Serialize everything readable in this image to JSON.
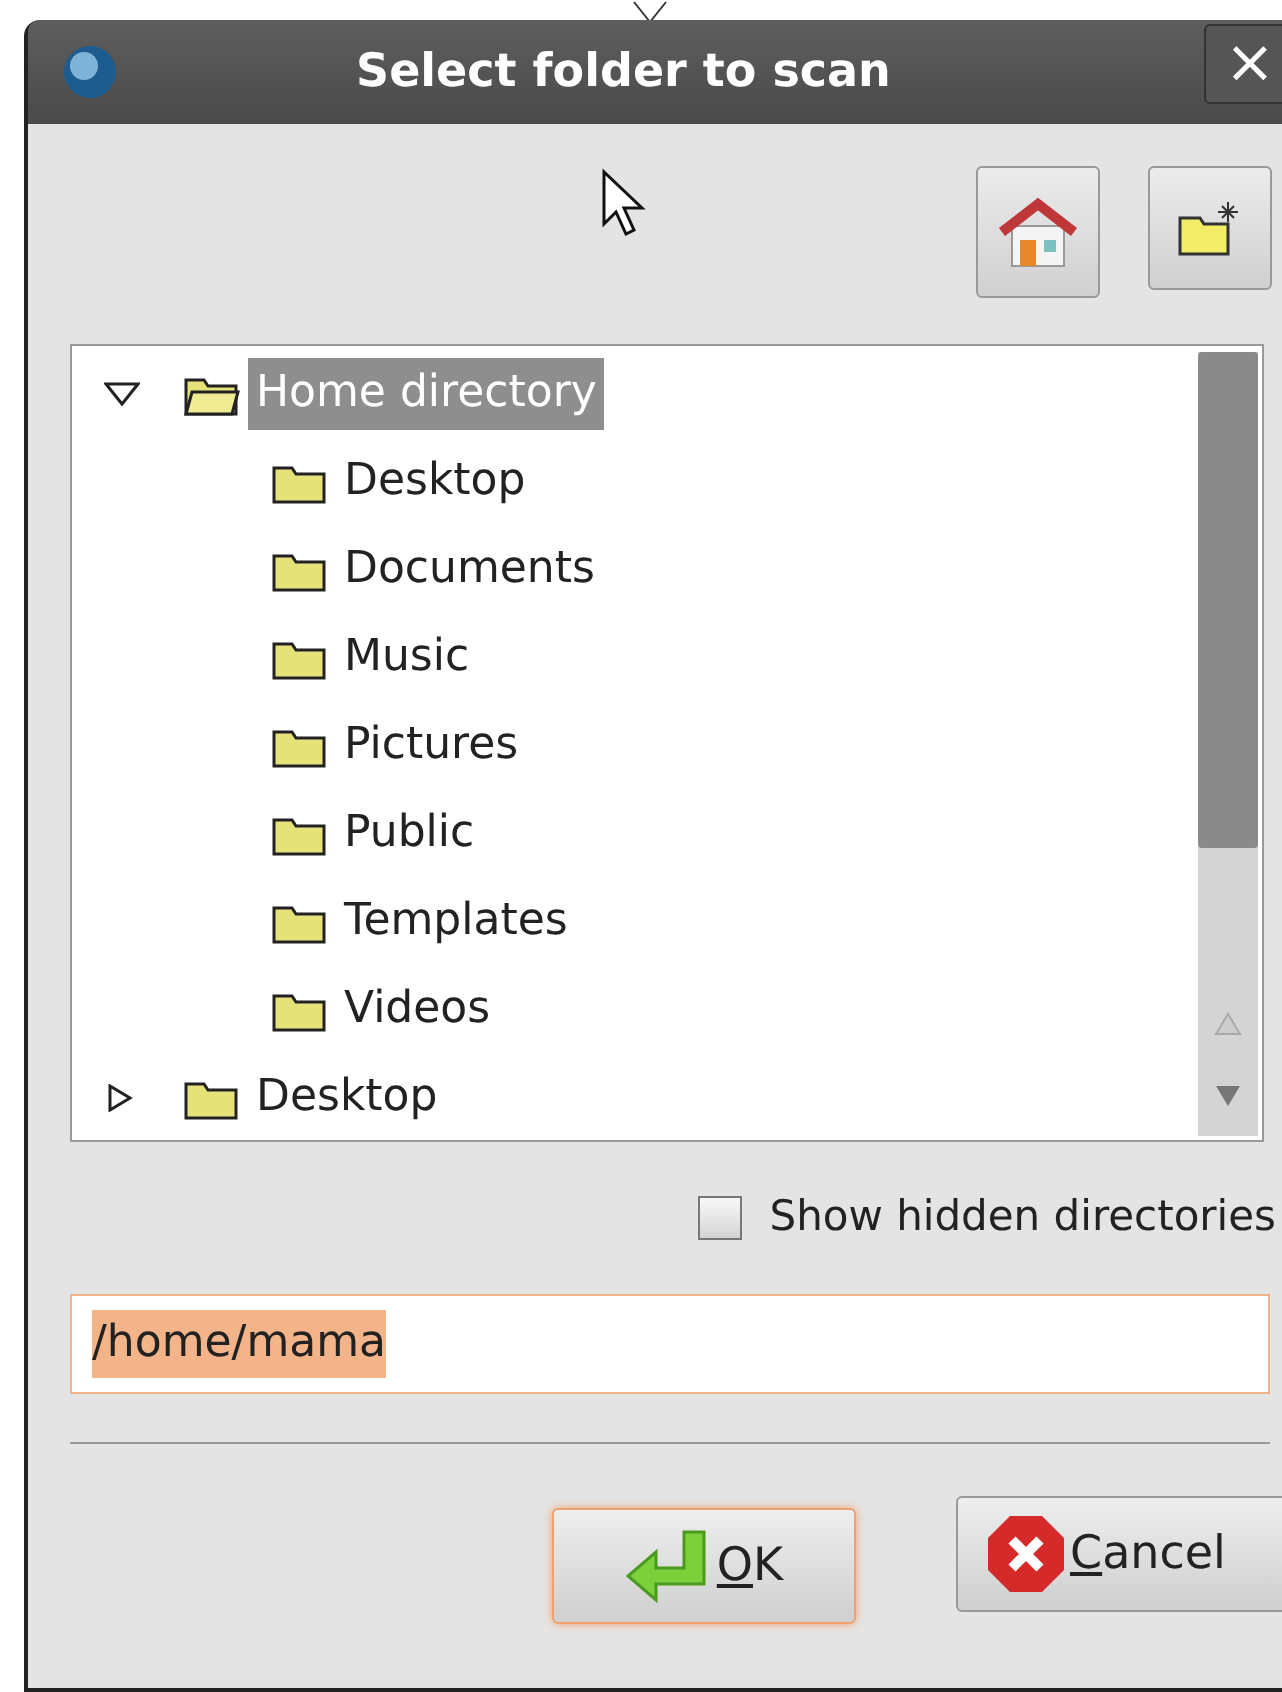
{
  "window": {
    "title": "Select folder to scan",
    "close_label": "×"
  },
  "tree": [
    {
      "label": "Home directory",
      "expanded": true,
      "selected": true,
      "children": [
        {
          "label": "Desktop",
          "selected": false
        },
        {
          "label": "Documents",
          "selected": false
        },
        {
          "label": "Music",
          "selected": false
        },
        {
          "label": "Pictures",
          "selected": false
        },
        {
          "label": "Public",
          "selected": false
        },
        {
          "label": "Templates",
          "selected": false
        },
        {
          "label": "Videos",
          "selected": false
        }
      ]
    },
    {
      "label": "Desktop",
      "expanded": false,
      "selected": false
    }
  ],
  "show_hidden": {
    "label": "Show hidden directories",
    "checked": false
  },
  "path_field": {
    "value": "/home/mama"
  },
  "buttons": [
    {
      "label": "OK",
      "kind": "ok",
      "focused": true
    },
    {
      "label": "Cancel",
      "kind": "cancel",
      "focused": false
    }
  ]
}
